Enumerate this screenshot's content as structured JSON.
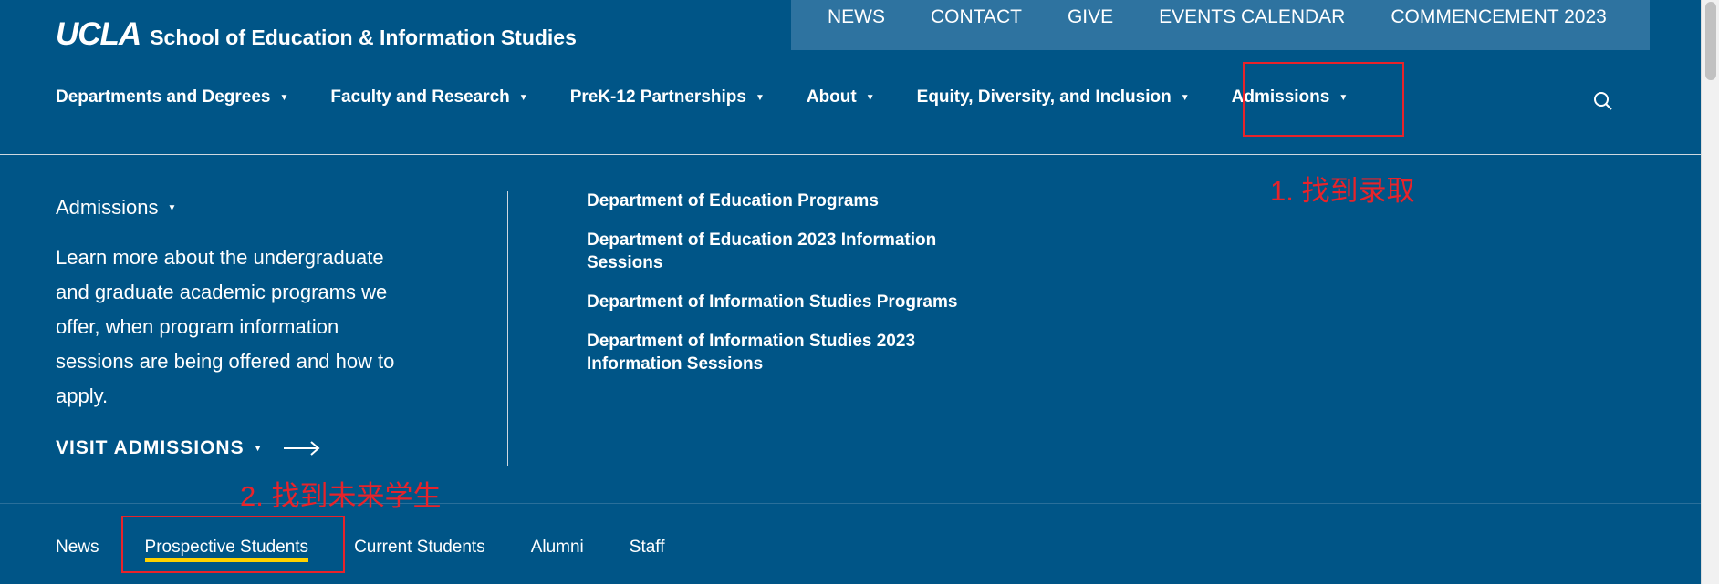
{
  "header": {
    "logo_ucla": "UCLA",
    "logo_school": "School of Education & Information Studies"
  },
  "utility_nav": [
    "NEWS",
    "CONTACT",
    "GIVE",
    "EVENTS CALENDAR",
    "COMMENCEMENT 2023"
  ],
  "main_nav": [
    "Departments and Degrees",
    "Faculty and Research",
    "PreK-12 Partnerships",
    "About",
    "Equity, Diversity, and Inclusion",
    "Admissions"
  ],
  "mega_menu": {
    "title": "Admissions",
    "description": "Learn more about the undergraduate and graduate academic programs we offer, when program information sessions are being offered and how to apply.",
    "cta": "VISIT ADMISSIONS",
    "links": [
      "Department of Education Programs",
      "Department of Education 2023 Information Sessions",
      "Department of Information Studies Programs",
      "Department of Information Studies 2023 Information Sessions"
    ]
  },
  "audience_nav": [
    "News",
    "Prospective Students",
    "Current Students",
    "Alumni",
    "Staff"
  ],
  "annotations": {
    "step1": "1. 找到录取",
    "step2": "2. 找到未来学生"
  },
  "colors": {
    "background": "#005587",
    "utility_bar": "#2e73a0",
    "accent_underline": "#ffd100",
    "annotation_red": "#e8232a"
  }
}
